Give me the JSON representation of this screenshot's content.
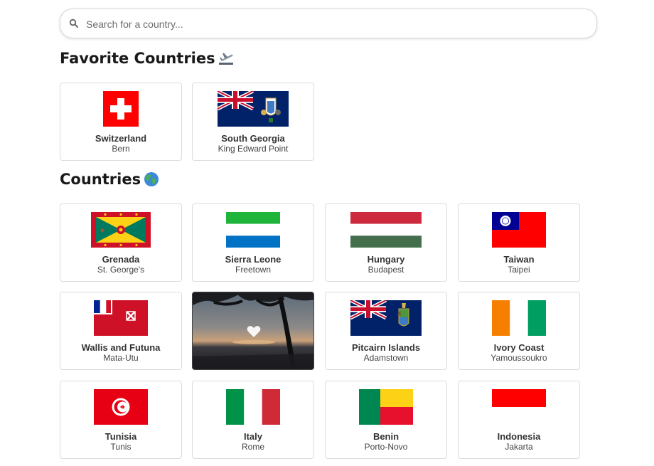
{
  "search": {
    "placeholder": "Search for a country..."
  },
  "favorites": {
    "title": "Favorite Countries",
    "icon": "airplane-departure-icon",
    "items": [
      {
        "name": "Switzerland",
        "capital": "Bern"
      },
      {
        "name": "South Georgia",
        "capital": "King Edward Point"
      }
    ]
  },
  "countries": {
    "title": "Countries",
    "icon": "globe-icon",
    "items": [
      {
        "name": "Grenada",
        "capital": "St. George's"
      },
      {
        "name": "Sierra Leone",
        "capital": "Freetown"
      },
      {
        "name": "Hungary",
        "capital": "Budapest"
      },
      {
        "name": "Taiwan",
        "capital": "Taipei"
      },
      {
        "name": "Wallis and Futuna",
        "capital": "Mata-Utu"
      },
      {
        "name": "",
        "capital": "",
        "hover_image": "sunset-beach-photo",
        "overlay_icon": "heart-icon"
      },
      {
        "name": "Pitcairn Islands",
        "capital": "Adamstown"
      },
      {
        "name": "Ivory Coast",
        "capital": "Yamoussoukro"
      },
      {
        "name": "Tunisia",
        "capital": "Tunis"
      },
      {
        "name": "Italy",
        "capital": "Rome"
      },
      {
        "name": "Benin",
        "capital": "Porto-Novo"
      },
      {
        "name": "Indonesia",
        "capital": "Jakarta"
      }
    ]
  }
}
